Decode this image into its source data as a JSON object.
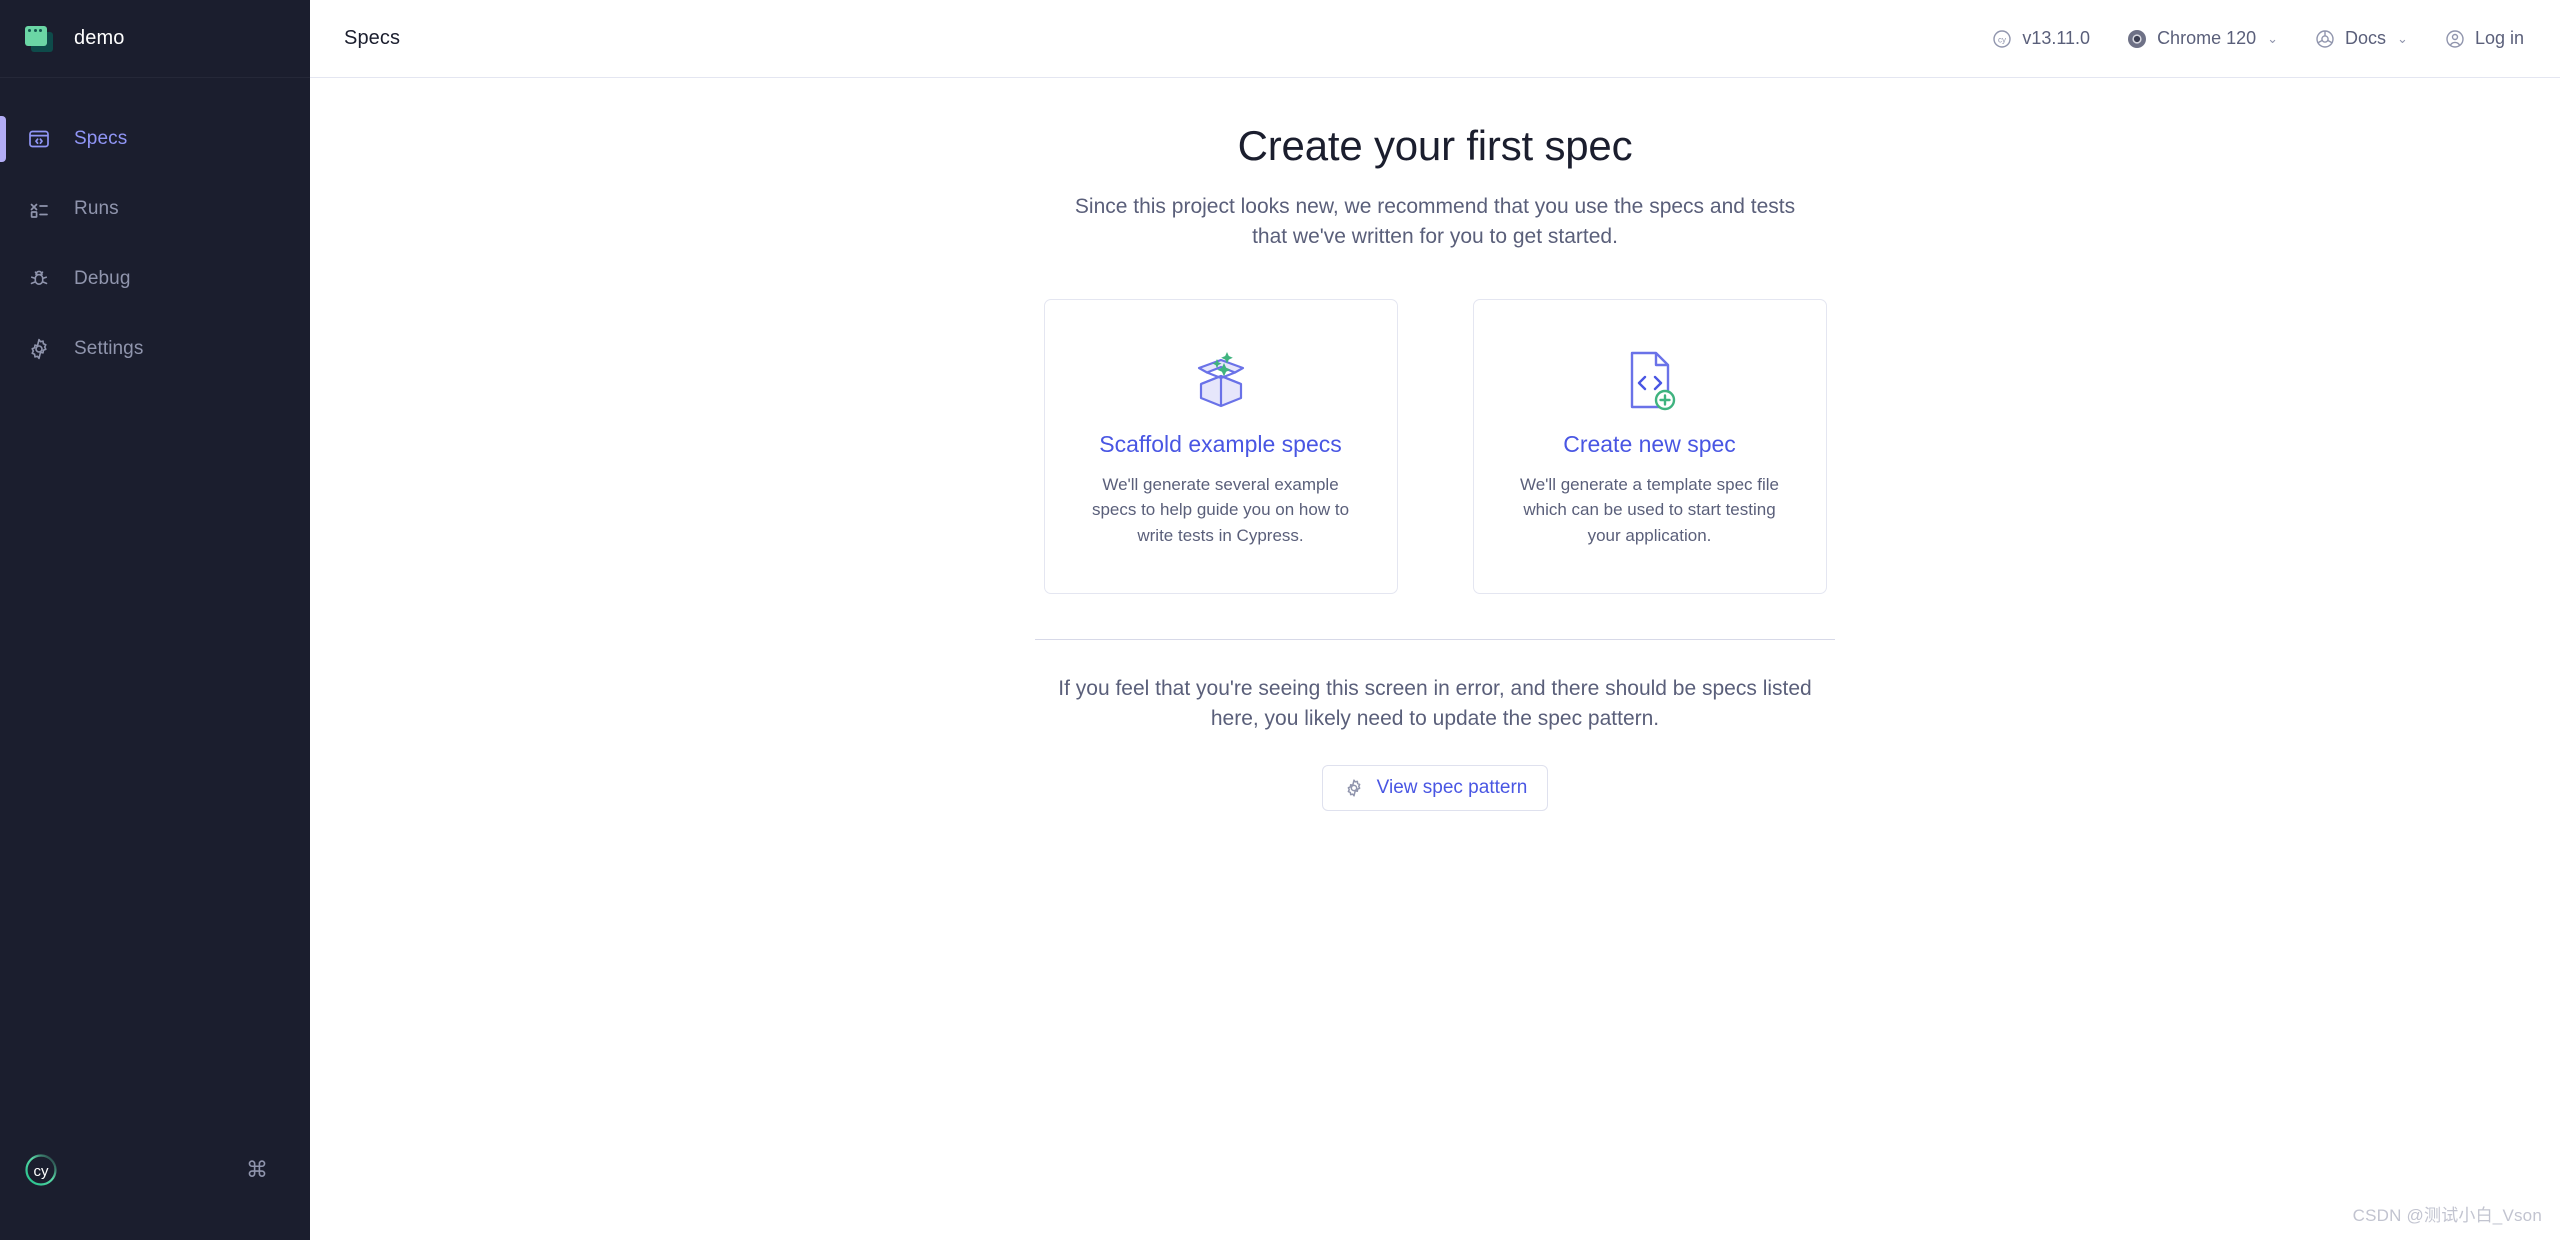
{
  "sidebar": {
    "project": {
      "name": "demo",
      "icon": "project-window-icon"
    },
    "items": [
      {
        "label": "Specs",
        "icon": "specs-browser-icon",
        "active": true
      },
      {
        "label": "Runs",
        "icon": "runs-list-icon",
        "active": false
      },
      {
        "label": "Debug",
        "icon": "debug-bug-icon",
        "active": false
      },
      {
        "label": "Settings",
        "icon": "settings-gear-icon",
        "active": false
      }
    ],
    "footer": {
      "logo": "cypress-logo",
      "shortcut_icon": "command-key-icon"
    }
  },
  "header": {
    "title": "Specs",
    "version": {
      "label": "v13.11.0",
      "icon": "cypress-circle-icon"
    },
    "browser": {
      "label": "Chrome 120",
      "icon": "chrome-icon",
      "chevron": "⌄"
    },
    "docs": {
      "label": "Docs",
      "icon": "docs-globe-icon",
      "chevron": "⌄"
    },
    "login": {
      "label": "Log in",
      "icon": "user-circle-icon"
    }
  },
  "main": {
    "headline": "Create your first spec",
    "subtitle": "Since this project looks new, we recommend that you use the specs and tests that we've written for you to get started.",
    "cards": [
      {
        "title": "Scaffold example specs",
        "description": "We'll generate several example specs to help guide you on how to write tests in Cypress.",
        "icon": "open-box-sparkles-icon"
      },
      {
        "title": "Create new spec",
        "description": "We'll generate a template spec file which can be used to start testing your application.",
        "icon": "code-file-plus-icon"
      }
    ],
    "error_note": "If you feel that you're seeing this screen in error, and there should be specs listed here, you likely need to update the spec pattern.",
    "pattern_button": {
      "label": "View spec pattern",
      "icon": "gear-icon"
    }
  },
  "watermark": "CSDN @测试小白_Vson",
  "colors": {
    "sidebar_bg": "#1b1e2e",
    "accent_indigo": "#4956e3",
    "active_nav": "#9095f5",
    "active_bar": "#b3adf5",
    "muted_text": "#5a5f7a",
    "border": "#e4e6f1",
    "green": "#3fb37f"
  }
}
